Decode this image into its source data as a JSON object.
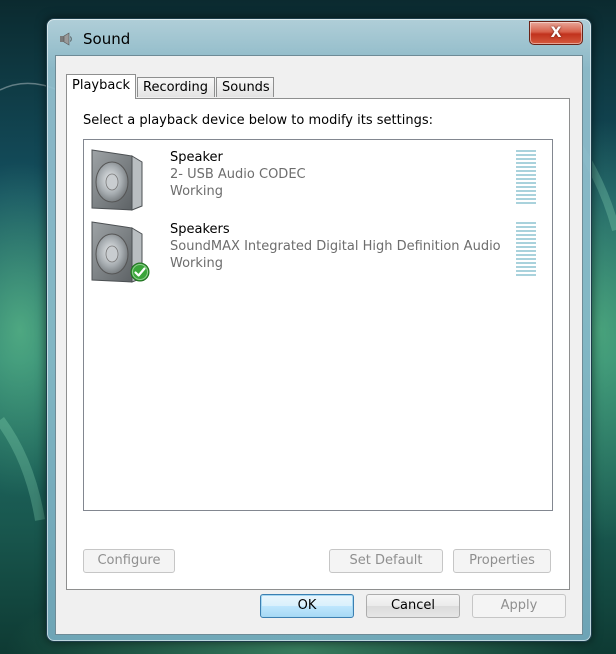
{
  "window": {
    "title": "Sound",
    "close_label": "X"
  },
  "tabs": [
    {
      "label": "Playback",
      "active": true
    },
    {
      "label": "Recording",
      "active": false
    },
    {
      "label": "Sounds",
      "active": false
    }
  ],
  "playback": {
    "instruction": "Select a playback device below to modify its settings:",
    "devices": [
      {
        "name": "Speaker",
        "description": "2- USB Audio CODEC",
        "status": "Working",
        "icon": "speaker-icon",
        "is_default": false
      },
      {
        "name": "Speakers",
        "description": "SoundMAX Integrated Digital High Definition Audio",
        "status": "Working",
        "icon": "speaker-icon",
        "is_default": true
      }
    ]
  },
  "panel_buttons": {
    "configure": "Configure",
    "set_default": "Set Default",
    "properties": "Properties"
  },
  "dialog_buttons": {
    "ok": "OK",
    "cancel": "Cancel",
    "apply": "Apply"
  },
  "colors": {
    "close_button": "#c8402a",
    "default_check": "#3aa53a",
    "level_meter": "#a9d2dc"
  }
}
